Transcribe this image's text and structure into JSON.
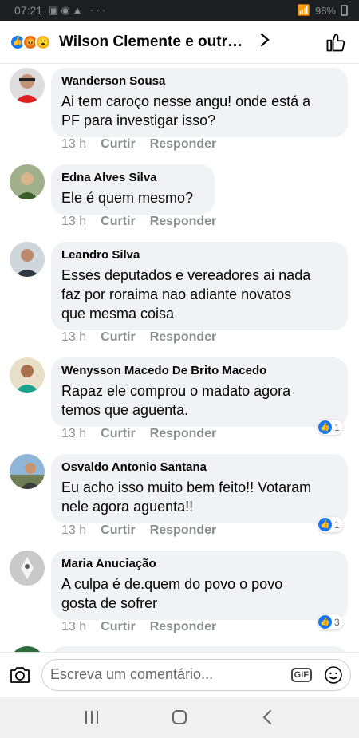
{
  "status": {
    "time": "07:21",
    "battery": "98%"
  },
  "header": {
    "title": "Wilson Clemente e outras..."
  },
  "comments": [
    {
      "name": "Wanderson Sousa",
      "text_lines": [
        "Ai tem caroço nesse angu! onde está a",
        "PF para investigar isso?"
      ],
      "time": "13 h",
      "like": "Curtir",
      "reply": "Responder",
      "reactions": null
    },
    {
      "name": "Edna Alves Silva",
      "text_lines": [
        "Ele é quem mesmo?"
      ],
      "time": "13 h",
      "like": "Curtir",
      "reply": "Responder",
      "reactions": null
    },
    {
      "name": "Leandro Silva",
      "text_lines": [
        "Esses  deputados  e vereadores ai nada",
        "faz por roraima  nao adiante novatos",
        "que mesma coisa"
      ],
      "time": "13 h",
      "like": "Curtir",
      "reply": "Responder",
      "reactions": null
    },
    {
      "name": "Wenysson Macedo De Brito Macedo",
      "text_lines": [
        "Rapaz ele comprou o madato agora",
        "temos que aguenta."
      ],
      "time": "13 h",
      "like": "Curtir",
      "reply": "Responder",
      "reactions": "1"
    },
    {
      "name": "Osvaldo Antonio Santana",
      "text_lines": [
        "Eu acho isso muito bem feito!! Votaram",
        "nele agora aguenta!!"
      ],
      "time": "13 h",
      "like": "Curtir",
      "reply": "Responder",
      "reactions": "1"
    },
    {
      "name": "Maria Anuciação",
      "text_lines": [
        "A culpa é de.quem do povo o povo",
        "gosta de sofrer"
      ],
      "time": "13 h",
      "like": "Curtir",
      "reply": "Responder",
      "reactions": "3"
    }
  ],
  "composer": {
    "placeholder": "Escreva um comentário...",
    "gif_label": "GIF"
  },
  "colors": {
    "accent": "#1877f2",
    "bubble": "#f0f2f5",
    "secondary_text": "#8a8d91"
  }
}
